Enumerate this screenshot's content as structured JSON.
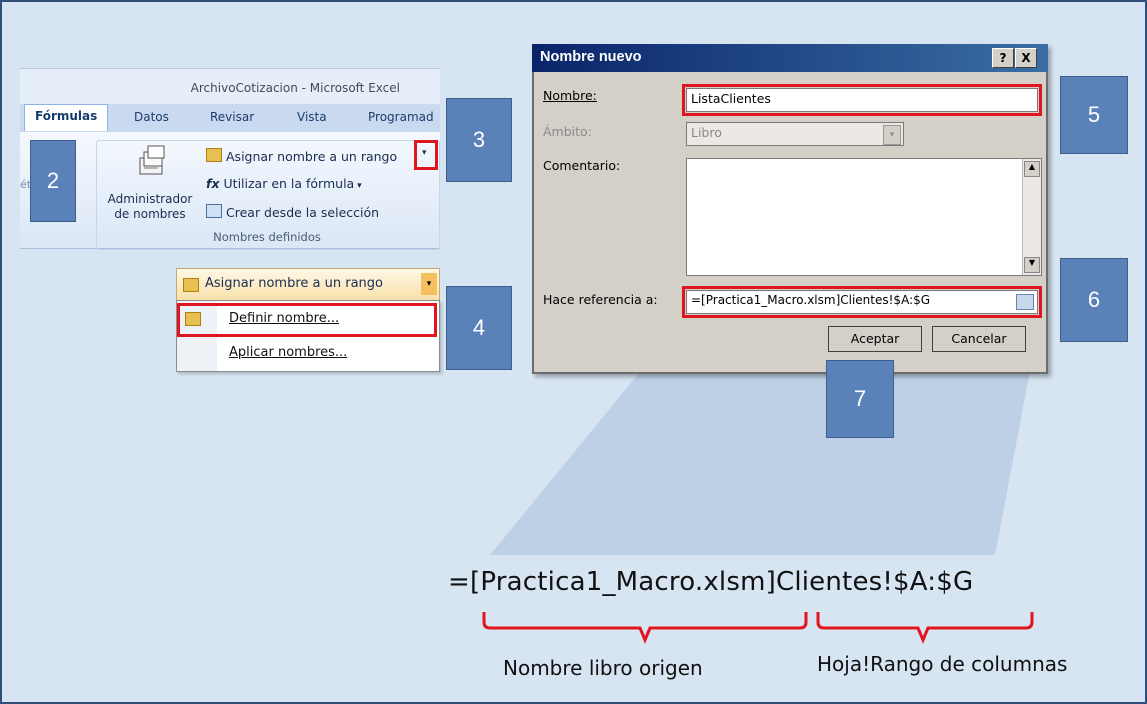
{
  "excel": {
    "window_title": "ArchivoCotizacion - Microsoft Excel",
    "tabs": [
      "Fórmulas",
      "Datos",
      "Revisar",
      "Vista",
      "Programad"
    ],
    "cut_label": "étricas",
    "admin_line1": "Administrador",
    "admin_line2": "de nombres",
    "commands": {
      "assign_name": "Asignar nombre a un rango",
      "use_in_formula": "Utilizar en la fórmula",
      "create_from_selection": "Crear desde la selección"
    },
    "group_label": "Nombres definidos"
  },
  "dropdown": {
    "header": "Asignar nombre a un rango",
    "items": [
      "Definir nombre...",
      "Aplicar nombres..."
    ]
  },
  "dialog": {
    "title": "Nombre nuevo",
    "help_btn": "?",
    "close_btn": "X",
    "name_label": "Nombre:",
    "name_value": "ListaClientes",
    "scope_label": "Ámbito:",
    "scope_value": "Libro",
    "comment_label": "Comentario:",
    "refers_label": "Hace referencia a:",
    "refers_value": "=[Practica1_Macro.xlsm]Clientes!$A:$G",
    "ok": "Aceptar",
    "cancel": "Cancelar"
  },
  "callouts": [
    "2",
    "3",
    "4",
    "5",
    "6",
    "7"
  ],
  "annotation": {
    "formula": "=[Practica1_Macro.xlsm]Clientes!$A:$G",
    "left_caption": "Nombre libro origen",
    "right_caption": "Hoja!Rango de columnas"
  },
  "colors": {
    "callout": "#5b82b8",
    "highlight": "#e0161e",
    "dialog_title": "#0a246a"
  }
}
